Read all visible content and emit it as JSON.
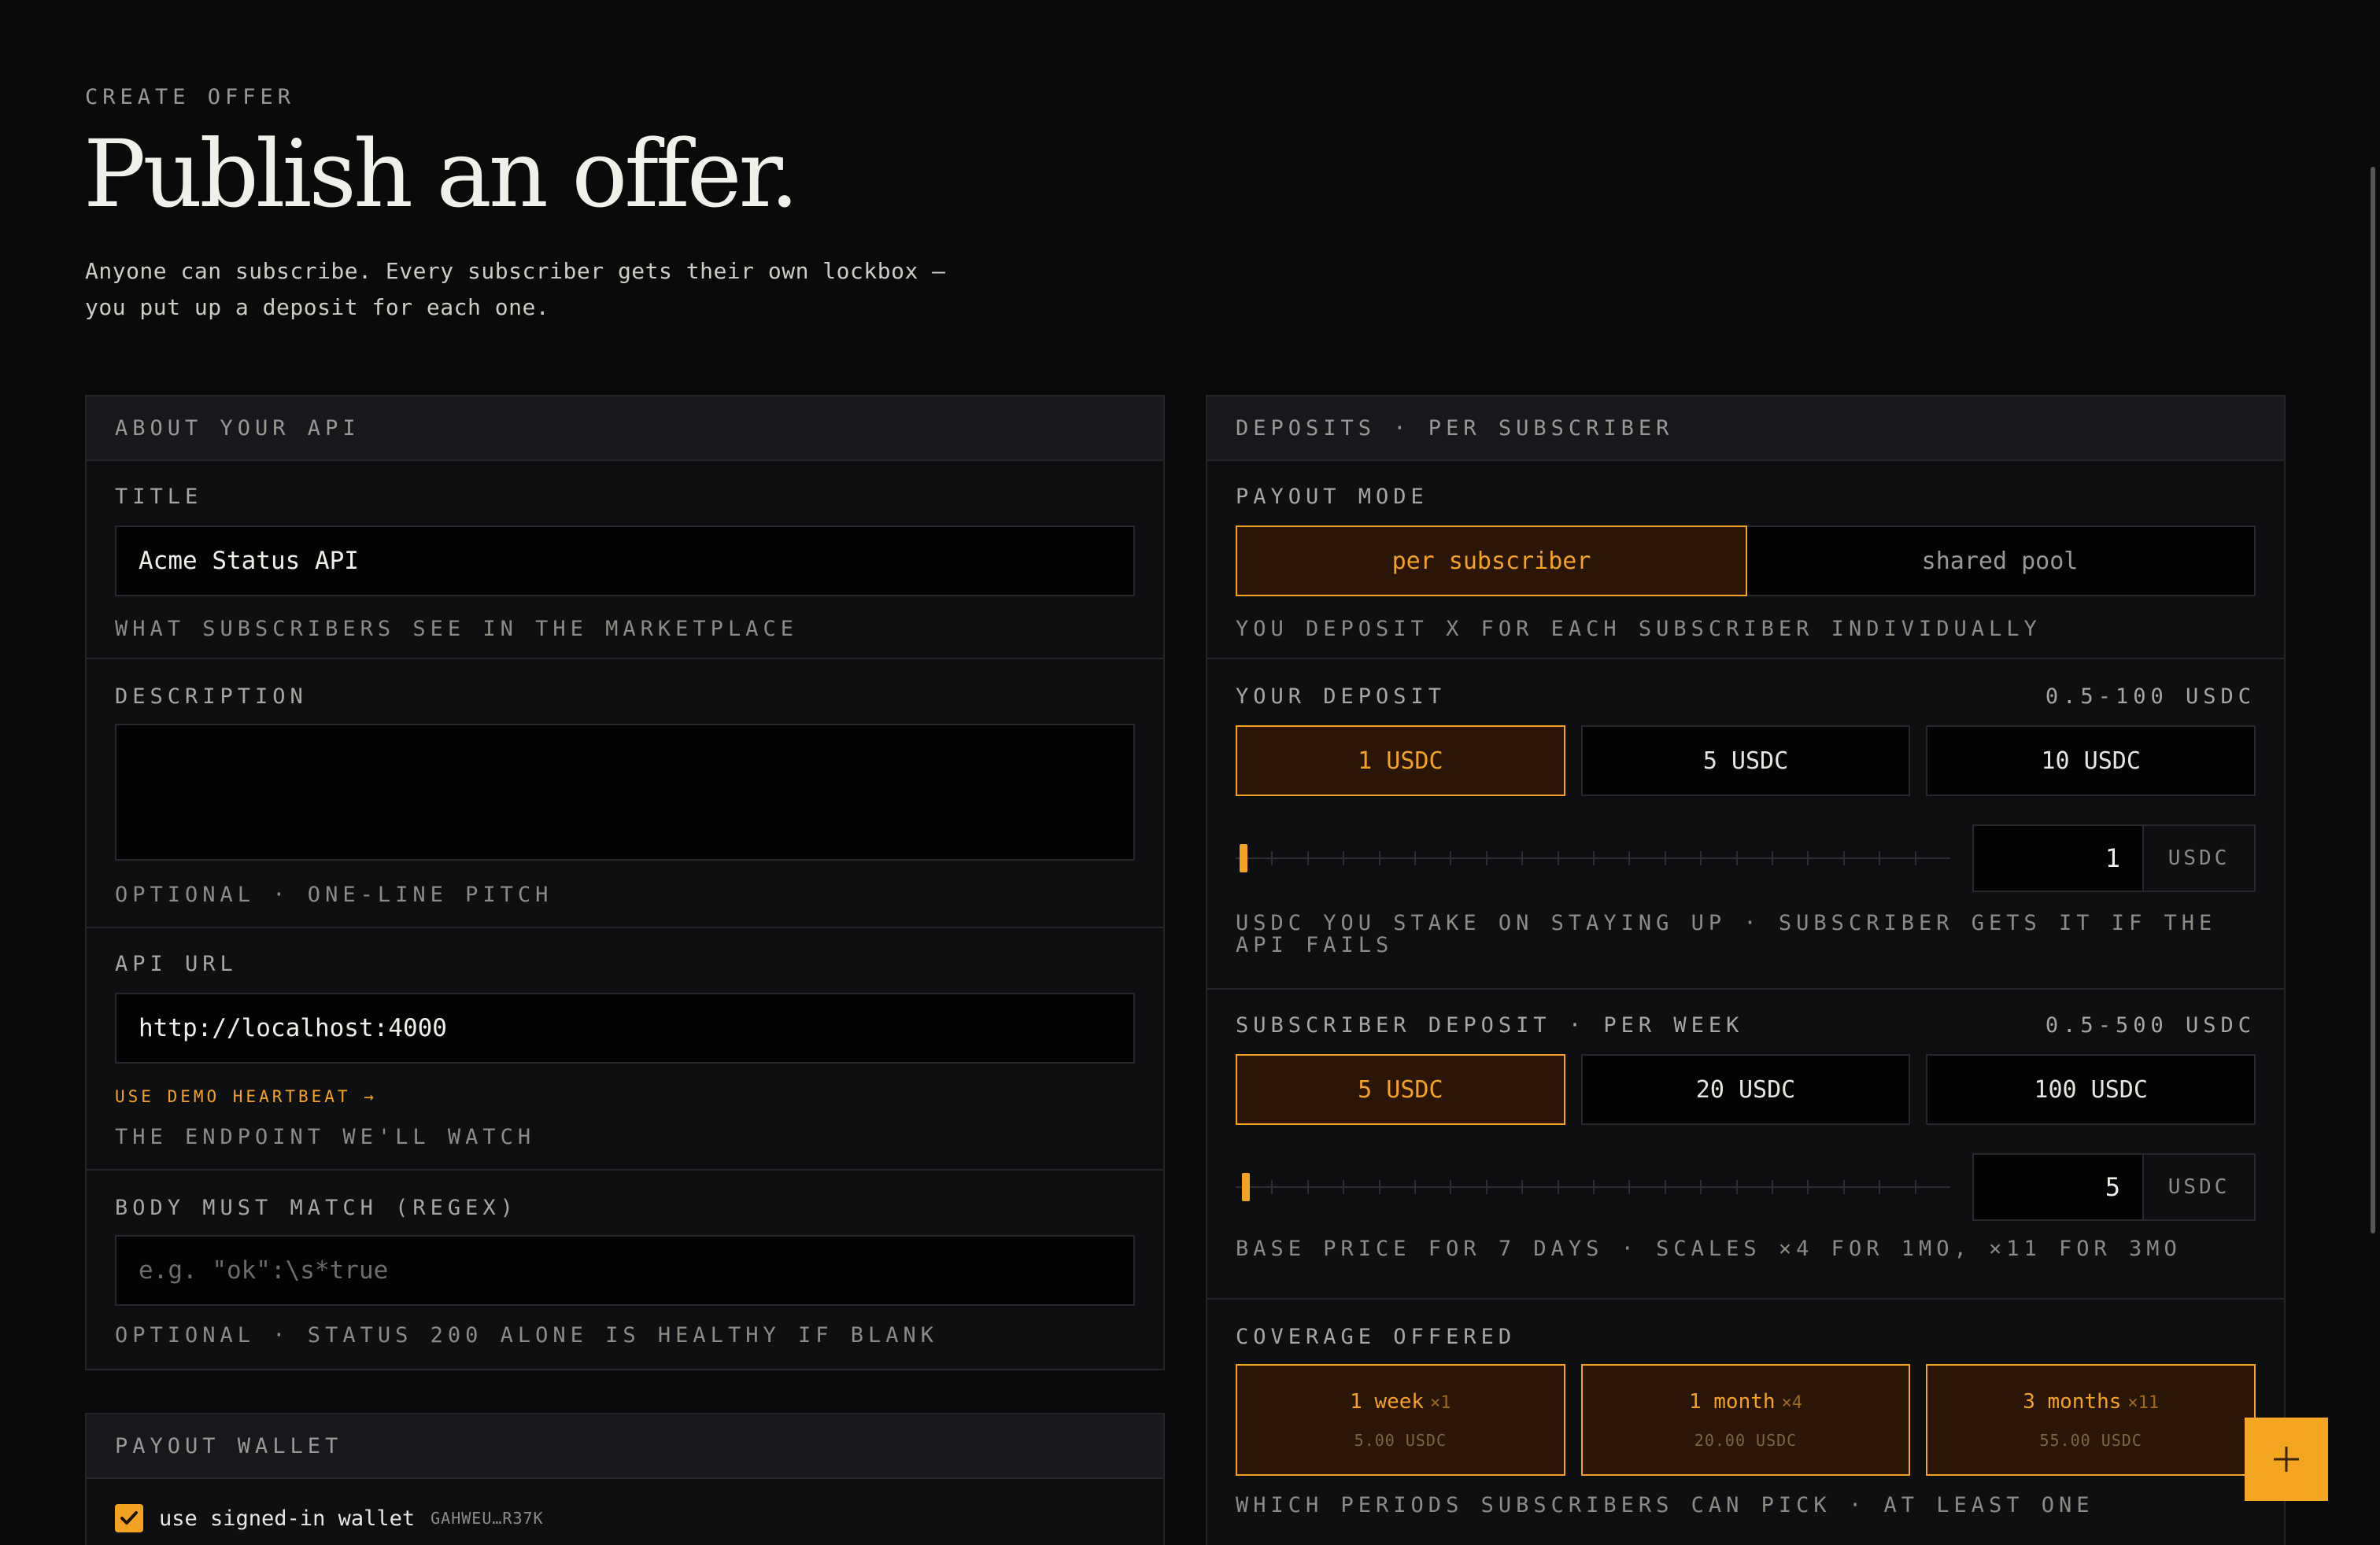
{
  "header": {
    "eyebrow": "CREATE OFFER",
    "title": "Publish an offer.",
    "intro": "Anyone can subscribe. Every subscriber gets their own lockbox — you put up a deposit for each one."
  },
  "about": {
    "heading": "ABOUT YOUR API",
    "title_label": "TITLE",
    "title_value": "Acme Status API",
    "title_hint": "WHAT SUBSCRIBERS SEE IN THE MARKETPLACE",
    "description_label": "DESCRIPTION",
    "description_value": "",
    "description_hint": "OPTIONAL · ONE-LINE PITCH",
    "url_label": "API URL",
    "url_value": "http://localhost:4000",
    "demo_link": "USE DEMO HEARTBEAT →",
    "url_hint": "THE ENDPOINT WE'LL WATCH",
    "regex_label": "BODY MUST MATCH (REGEX)",
    "regex_placeholder": "e.g. \"ok\":\\s*true",
    "regex_hint": "OPTIONAL · STATUS 200 ALONE IS HEALTHY IF BLANK"
  },
  "wallet": {
    "heading": "PAYOUT WALLET",
    "checkbox_label": "use signed-in wallet",
    "checked": true,
    "wallet_id": "GAHWEU…R37K"
  },
  "deposits": {
    "heading": "DEPOSITS · PER SUBSCRIBER",
    "payout_label": "PAYOUT MODE",
    "payout_options": [
      "per subscriber",
      "shared pool"
    ],
    "payout_selected": 0,
    "payout_hint": "YOU DEPOSIT X FOR EACH SUBSCRIBER INDIVIDUALLY",
    "your_deposit": {
      "label": "YOUR DEPOSIT",
      "range": "0.5-100 USDC",
      "chips": [
        "1 USDC",
        "5 USDC",
        "10 USDC"
      ],
      "selected": 0,
      "value": "1",
      "unit": "USDC",
      "slider_fraction": 0.005,
      "hint": "USDC YOU STAKE ON STAYING UP · SUBSCRIBER GETS IT IF THE API FAILS"
    },
    "subscriber_deposit": {
      "label": "SUBSCRIBER DEPOSIT · PER WEEK",
      "range": "0.5-500 USDC",
      "chips": [
        "5 USDC",
        "20 USDC",
        "100 USDC"
      ],
      "selected": 0,
      "value": "5",
      "unit": "USDC",
      "slider_fraction": 0.009,
      "hint": "BASE PRICE FOR 7 DAYS · SCALES ×4 FOR 1MO, ×11 FOR 3MO"
    },
    "coverage": {
      "label": "COVERAGE OFFERED",
      "options": [
        {
          "period": "1 week",
          "mult": "×1",
          "price": "5.00 USDC"
        },
        {
          "period": "1 month",
          "mult": "×4",
          "price": "20.00 USDC"
        },
        {
          "period": "3 months",
          "mult": "×11",
          "price": "55.00 USDC"
        }
      ],
      "hint": "WHICH PERIODS SUBSCRIBERS CAN PICK · AT LEAST ONE"
    }
  },
  "colors": {
    "accent": "#f4a221",
    "background": "#0a0a0b",
    "panel": "#0e0f11"
  },
  "icons": {
    "fab": "plus-icon",
    "checkbox": "check-icon"
  }
}
